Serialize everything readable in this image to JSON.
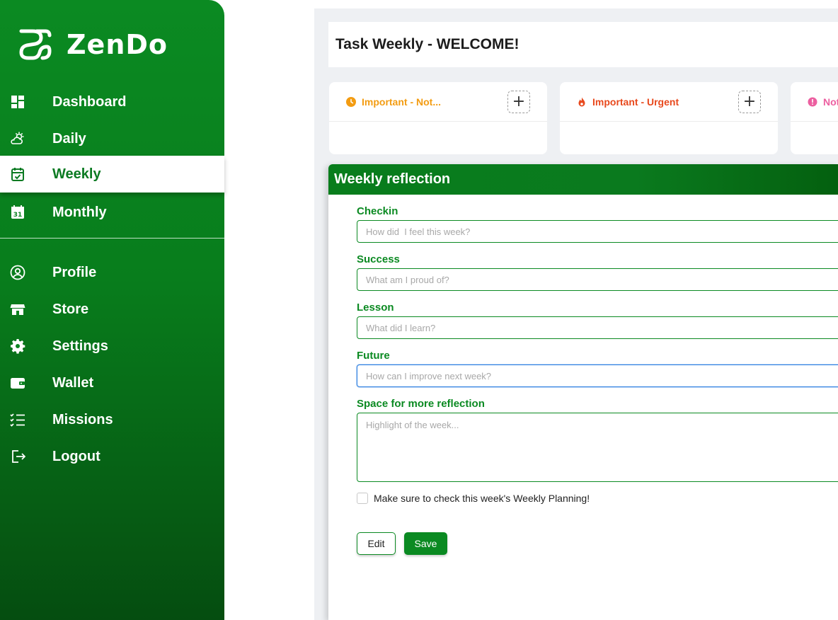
{
  "app": {
    "name": "ZenDo"
  },
  "sidebar": {
    "items": [
      {
        "label": "Dashboard",
        "icon": "dashboard-icon",
        "active": false
      },
      {
        "label": "Daily",
        "icon": "sun-cloud-icon",
        "active": false
      },
      {
        "label": "Weekly",
        "icon": "calendar-check-icon",
        "active": true
      },
      {
        "label": "Monthly",
        "icon": "calendar-31-icon",
        "active": false
      },
      {
        "label": "Profile",
        "icon": "user-circle-icon",
        "active": false
      },
      {
        "label": "Store",
        "icon": "store-icon",
        "active": false
      },
      {
        "label": "Settings",
        "icon": "gear-icon",
        "active": false
      },
      {
        "label": "Wallet",
        "icon": "wallet-icon",
        "active": false
      },
      {
        "label": "Missions",
        "icon": "checklist-icon",
        "active": false
      },
      {
        "label": "Logout",
        "icon": "logout-icon",
        "active": false
      }
    ]
  },
  "header": {
    "title": "Task Weekly - WELCOME!"
  },
  "quadrants": [
    {
      "label": "Important - Not...",
      "color": "#f39c12",
      "icon": "clock-icon",
      "add": "+"
    },
    {
      "label": "Important - Urgent",
      "color": "#e8491d",
      "icon": "fire-icon",
      "add": "+"
    },
    {
      "label": "Not",
      "color": "#ec5fa0",
      "icon": "alert-icon"
    }
  ],
  "reflection": {
    "title": "Weekly reflection",
    "fields": [
      {
        "label": "Checkin",
        "placeholder": "How did  I feel this week?"
      },
      {
        "label": "Success",
        "placeholder": "What am I proud of?"
      },
      {
        "label": "Lesson",
        "placeholder": "What did I learn?"
      },
      {
        "label": "Future",
        "placeholder": "How can I improve next week?"
      }
    ],
    "more": {
      "label": "Space for more reflection",
      "placeholder": "Highlight of the week..."
    },
    "checkbox_label": "Make sure to check this week's Weekly Planning!",
    "edit_label": "Edit",
    "save_label": "Save"
  },
  "colors": {
    "brand": "#0b8a22",
    "focus": "#2d7fe0"
  }
}
